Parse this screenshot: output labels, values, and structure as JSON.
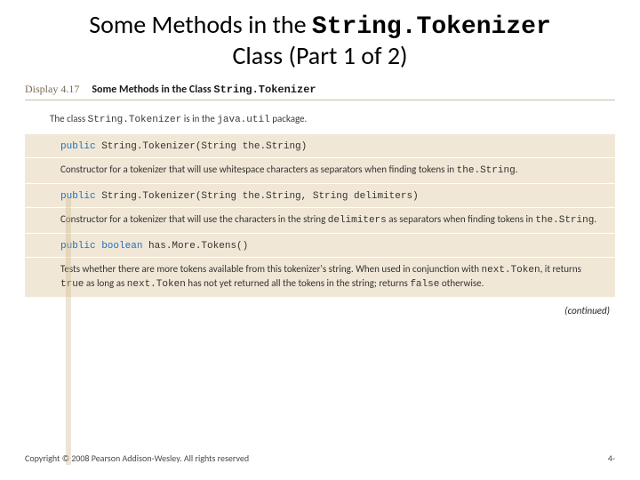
{
  "title": {
    "pre": "Some Methods in the ",
    "mono": "String.Tokenizer",
    "post": " Class (Part 1 of 2)"
  },
  "display": {
    "label": "Display 4.17",
    "heading_pre": "Some Methods in the Class ",
    "heading_mono": "String.Tokenizer"
  },
  "intro": {
    "pre": "The class ",
    "m1": "String.Tokenizer",
    "mid": " is in the ",
    "m2": "java.util",
    "post": " package."
  },
  "rows": {
    "r0_kw": "public",
    "r0_sig": " String.Tokenizer(String the.String)",
    "r1_pre": "Constructor for a tokenizer that will use whitespace characters as separators when finding tokens in ",
    "r1_m": "the.String",
    "r1_post": ".",
    "r2_kw": "public",
    "r2_sig": " String.Tokenizer(String the.String, String delimiters)",
    "r3_pre": "Constructor for a tokenizer that will use the characters in the string ",
    "r3_m": "delimiters",
    "r3_mid": " as separators when finding tokens in ",
    "r3_m2": "the.String",
    "r3_post": ".",
    "r4_kw": "public boolean",
    "r4_sig": " has.More.Tokens()",
    "r5_pre": "Tests whether there are more tokens available from this tokenizer's string. When used in conjunction with ",
    "r5_m1": "next.Token",
    "r5_mid1": ", it returns ",
    "r5_m2": "true",
    "r5_mid2": " as long as ",
    "r5_m3": "next.Token",
    "r5_mid3": " has not yet returned all the tokens in the string; returns ",
    "r5_m4": "false",
    "r5_post": " otherwise."
  },
  "continued": "(continued)",
  "footer": {
    "copyright": "Copyright © 2008 Pearson Addison-Wesley. All rights reserved",
    "page": "4-"
  }
}
